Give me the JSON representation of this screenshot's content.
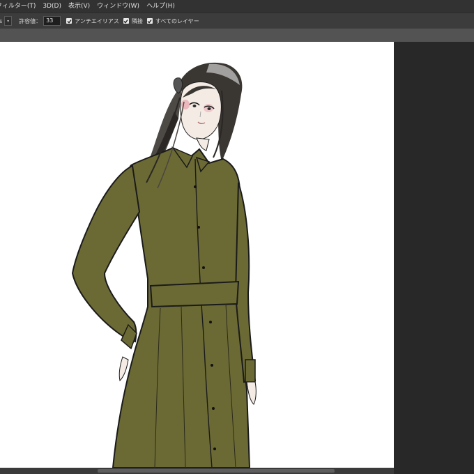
{
  "menubar": {
    "items": [
      "フィルター(T)",
      "3D(D)",
      "表示(V)",
      "ウィンドウ(W)",
      "ヘルプ(H)"
    ]
  },
  "options": {
    "partial_value": "s",
    "tolerance_label": "許容値：",
    "tolerance_value": "33",
    "antialias_label": "アンチエイリアス",
    "contiguous_label": "隣接",
    "all_layers_label": "すべてのレイヤー"
  },
  "artwork": {
    "subject": "fashion illustration of a woman with long dark hair in an olive green long-sleeve belted shirt dress",
    "dress_color": "#6b6a35",
    "hair_color": "#3a3632",
    "outline_color": "#1a1a1a"
  },
  "colors": {
    "menubar": "#323232",
    "optionsbar": "#3c3c3c",
    "workspace": "#535353",
    "panel": "#282828"
  }
}
